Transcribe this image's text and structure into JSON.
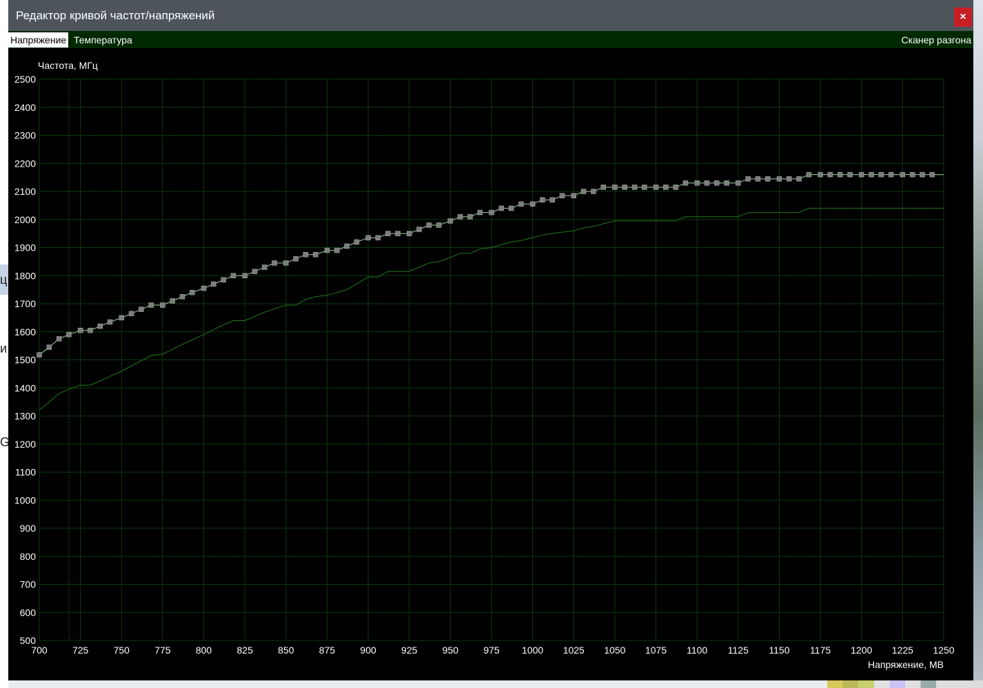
{
  "window": {
    "title": "Редактор кривой частот/напряжений",
    "close_label": "×"
  },
  "tabs": {
    "voltage": "Напряжение",
    "temperature": "Температура",
    "scanner": "Сканер разгона"
  },
  "background": {
    "left_chars": [
      "ц",
      "и",
      "G"
    ]
  },
  "colors": {
    "window_bg": "#000000",
    "titlebar": "#4d555b",
    "tabbar": "#002900",
    "grid": "#0b3a0b",
    "curve_main": "#9fd89f",
    "curve_secondary": "#1f7a1f",
    "point_fill": "#7c7c7c",
    "close_button": "#c61f25"
  },
  "chart_data": {
    "type": "line",
    "ylabel": "Частота, МГц",
    "xlabel": "Напряжение, МВ",
    "xlim": [
      700,
      1250
    ],
    "ylim": [
      500,
      2500
    ],
    "x_ticks": [
      700,
      725,
      750,
      775,
      800,
      825,
      850,
      875,
      900,
      925,
      950,
      975,
      1000,
      1025,
      1050,
      1075,
      1100,
      1125,
      1150,
      1175,
      1200,
      1225,
      1250
    ],
    "y_ticks": [
      500,
      600,
      700,
      800,
      900,
      1000,
      1100,
      1200,
      1300,
      1400,
      1500,
      1600,
      1700,
      1800,
      1900,
      2000,
      2100,
      2200,
      2300,
      2400,
      2500
    ],
    "grid": true,
    "marker_x": 718,
    "series": [
      {
        "x": [
          700,
          706,
          712,
          718,
          725,
          731,
          737,
          743,
          750,
          756,
          762,
          768,
          775,
          781,
          787,
          793,
          800,
          806,
          812,
          818,
          825,
          831,
          837,
          843,
          850,
          856,
          862,
          868,
          875,
          881,
          887,
          893,
          900,
          906,
          912,
          918,
          925,
          931,
          937,
          943,
          950,
          956,
          962,
          968,
          975,
          981,
          987,
          993,
          1000,
          1006,
          1012,
          1018,
          1025,
          1031,
          1037,
          1043,
          1050,
          1056,
          1062,
          1068,
          1075,
          1081,
          1087,
          1093,
          1100,
          1106,
          1112,
          1118,
          1125,
          1131,
          1137,
          1143,
          1150,
          1156,
          1162,
          1168,
          1175,
          1181,
          1187,
          1193,
          1200,
          1206,
          1212,
          1218,
          1225,
          1231,
          1237,
          1243
        ],
        "y": [
          1518,
          1545,
          1575,
          1590,
          1605,
          1605,
          1620,
          1635,
          1650,
          1665,
          1680,
          1695,
          1695,
          1710,
          1725,
          1740,
          1755,
          1770,
          1785,
          1800,
          1800,
          1815,
          1830,
          1845,
          1845,
          1860,
          1875,
          1875,
          1890,
          1890,
          1905,
          1920,
          1935,
          1935,
          1950,
          1950,
          1950,
          1965,
          1980,
          1980,
          1995,
          2010,
          2010,
          2025,
          2025,
          2040,
          2040,
          2055,
          2055,
          2070,
          2070,
          2085,
          2085,
          2100,
          2100,
          2115,
          2115,
          2115,
          2115,
          2115,
          2115,
          2115,
          2115,
          2130,
          2130,
          2130,
          2130,
          2130,
          2130,
          2145,
          2145,
          2145,
          2145,
          2145,
          2145,
          2160,
          2160,
          2160,
          2160,
          2160,
          2160,
          2160,
          2160,
          2160,
          2160,
          2160,
          2160,
          2160
        ]
      },
      {
        "x": [
          700,
          702,
          706,
          712,
          718,
          725,
          731,
          737,
          750,
          768,
          775,
          787,
          800,
          812,
          818,
          825,
          837,
          850,
          856,
          862,
          868,
          875,
          887,
          900,
          906,
          912,
          918,
          925,
          931,
          937,
          943,
          950,
          956,
          962,
          968,
          975,
          981,
          987,
          993,
          1000,
          1006,
          1012,
          1018,
          1025,
          1031,
          1037,
          1043,
          1050,
          1056,
          1062,
          1068,
          1075,
          1081,
          1087,
          1093,
          1100,
          1106,
          1112,
          1118,
          1125,
          1131,
          1137,
          1143,
          1150,
          1156,
          1162,
          1168,
          1175,
          1181,
          1187,
          1193,
          1200,
          1206,
          1212,
          1218,
          1225,
          1231,
          1237,
          1243,
          1250
        ],
        "y": [
          1320,
          1330,
          1350,
          1380,
          1395,
          1410,
          1410,
          1425,
          1460,
          1515,
          1520,
          1555,
          1590,
          1625,
          1640,
          1640,
          1670,
          1695,
          1695,
          1715,
          1725,
          1730,
          1750,
          1795,
          1795,
          1815,
          1815,
          1815,
          1830,
          1845,
          1850,
          1865,
          1880,
          1880,
          1895,
          1900,
          1910,
          1920,
          1925,
          1935,
          1945,
          1950,
          1955,
          1960,
          1970,
          1975,
          1985,
          1995,
          1995,
          1995,
          1995,
          1995,
          1995,
          1995,
          2010,
          2010,
          2010,
          2010,
          2010,
          2010,
          2025,
          2025,
          2025,
          2025,
          2025,
          2025,
          2040,
          2040,
          2040,
          2040,
          2040,
          2040,
          2040,
          2040,
          2040,
          2040,
          2040,
          2040,
          2040,
          2040
        ]
      }
    ]
  }
}
